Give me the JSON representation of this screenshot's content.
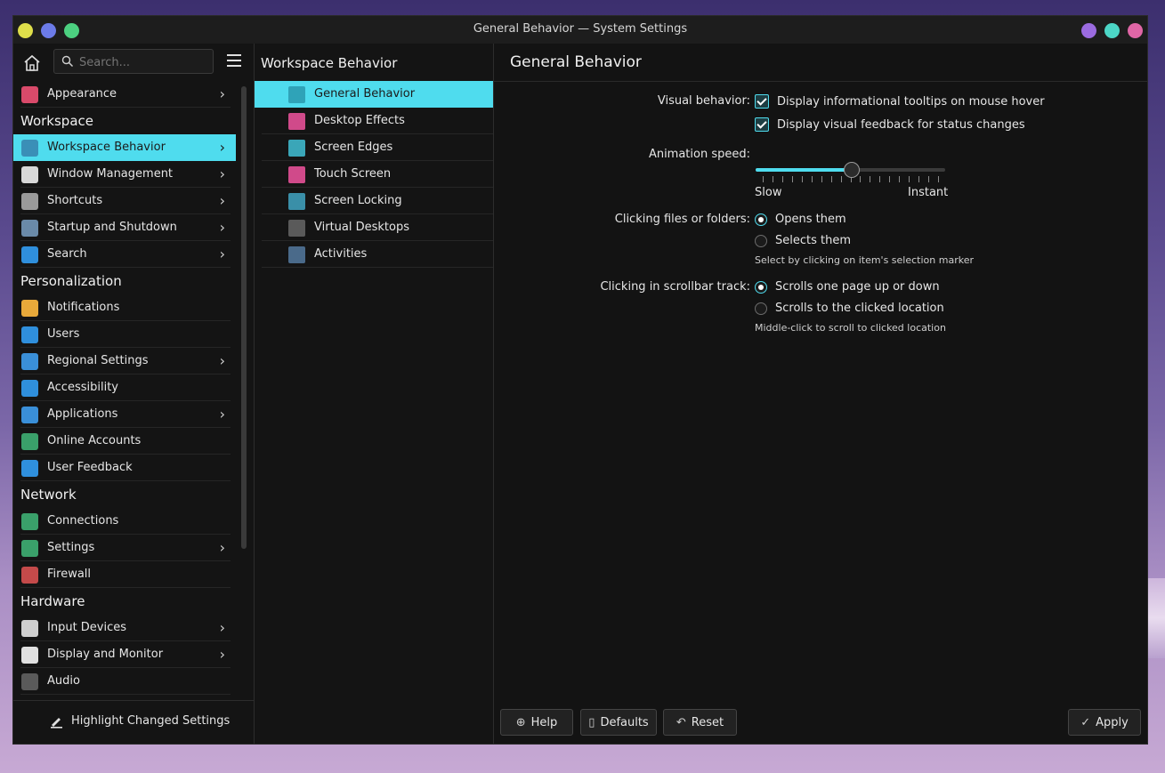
{
  "window": {
    "title": "General Behavior — System Settings",
    "left_buttons": [
      "#dede4a",
      "#6c7be8",
      "#4cd080"
    ],
    "right_buttons": [
      "#9b6be0",
      "#4cd6c6",
      "#e066a6"
    ]
  },
  "sidebar": {
    "search_placeholder": "Search...",
    "items": [
      {
        "kind": "item",
        "label": "Appearance",
        "icon": "appearance-icon",
        "color": "#d94a6a",
        "arrow": true
      },
      {
        "kind": "cat",
        "label": "Workspace"
      },
      {
        "kind": "item",
        "label": "Workspace Behavior",
        "icon": "workspace-behavior-icon",
        "color": "#3a8fb7",
        "arrow": true,
        "selected": true
      },
      {
        "kind": "item",
        "label": "Window Management",
        "icon": "window-management-icon",
        "color": "#d8d8d8",
        "arrow": true
      },
      {
        "kind": "item",
        "label": "Shortcuts",
        "icon": "keyboard-icon",
        "color": "#9a9a9a",
        "arrow": true
      },
      {
        "kind": "item",
        "label": "Startup and Shutdown",
        "icon": "startup-icon",
        "color": "#6a8aa8",
        "arrow": true
      },
      {
        "kind": "item",
        "label": "Search",
        "icon": "search-icon",
        "color": "#2f8fdc",
        "arrow": true
      },
      {
        "kind": "cat",
        "label": "Personalization"
      },
      {
        "kind": "item",
        "label": "Notifications",
        "icon": "bell-icon",
        "color": "#e8a93a",
        "arrow": false
      },
      {
        "kind": "item",
        "label": "Users",
        "icon": "users-icon",
        "color": "#2f8fdc",
        "arrow": false
      },
      {
        "kind": "item",
        "label": "Regional Settings",
        "icon": "regional-icon",
        "color": "#3a8fd8",
        "arrow": true
      },
      {
        "kind": "item",
        "label": "Accessibility",
        "icon": "accessibility-icon",
        "color": "#2f8fdc",
        "arrow": false
      },
      {
        "kind": "item",
        "label": "Applications",
        "icon": "applications-icon",
        "color": "#3a8fd8",
        "arrow": true
      },
      {
        "kind": "item",
        "label": "Online Accounts",
        "icon": "globe-icon",
        "color": "#3aa06a",
        "arrow": false
      },
      {
        "kind": "item",
        "label": "User Feedback",
        "icon": "feedback-icon",
        "color": "#2f8fdc",
        "arrow": false
      },
      {
        "kind": "cat",
        "label": "Network"
      },
      {
        "kind": "item",
        "label": "Connections",
        "icon": "connections-icon",
        "color": "#3aa06a",
        "arrow": false
      },
      {
        "kind": "item",
        "label": "Settings",
        "icon": "network-settings-icon",
        "color": "#3aa06a",
        "arrow": true
      },
      {
        "kind": "item",
        "label": "Firewall",
        "icon": "firewall-icon",
        "color": "#c44a4a",
        "arrow": false
      },
      {
        "kind": "cat",
        "label": "Hardware"
      },
      {
        "kind": "item",
        "label": "Input Devices",
        "icon": "mouse-icon",
        "color": "#cfcfcf",
        "arrow": true
      },
      {
        "kind": "item",
        "label": "Display and Monitor",
        "icon": "monitor-icon",
        "color": "#e0e0e0",
        "arrow": true
      },
      {
        "kind": "item",
        "label": "Audio",
        "icon": "speaker-icon",
        "color": "#5a5a5a",
        "arrow": false
      }
    ],
    "highlight_button": "Highlight Changed Settings"
  },
  "middle": {
    "title": "Workspace Behavior",
    "items": [
      {
        "label": "General Behavior",
        "icon": "general-behavior-icon",
        "color": "#2fa3b8",
        "selected": true
      },
      {
        "label": "Desktop Effects",
        "icon": "desktop-effects-icon",
        "color": "#d04a8a"
      },
      {
        "label": "Screen Edges",
        "icon": "screen-edges-icon",
        "color": "#3aa6b8"
      },
      {
        "label": "Touch Screen",
        "icon": "touch-screen-icon",
        "color": "#d04a8a"
      },
      {
        "label": "Screen Locking",
        "icon": "screen-locking-icon",
        "color": "#3a8fa8"
      },
      {
        "label": "Virtual Desktops",
        "icon": "virtual-desktops-icon",
        "color": "#5a5a5a"
      },
      {
        "label": "Activities",
        "icon": "activities-icon",
        "color": "#4a6a8a"
      }
    ]
  },
  "content": {
    "title": "General Behavior",
    "visual_behavior_label": "Visual behavior:",
    "tooltips_option": "Display informational tooltips on mouse hover",
    "tooltips_checked": true,
    "feedback_option": "Display visual feedback for status changes",
    "feedback_checked": true,
    "animation_label": "Animation speed:",
    "animation_value": 0.5,
    "slider_min_label": "Slow",
    "slider_max_label": "Instant",
    "slider_ticks": 19,
    "clicking_files_label": "Clicking files or folders:",
    "opens_them": "Opens them",
    "selects_them": "Selects them",
    "select_hint": "Select by clicking on item's selection marker",
    "scrollbar_label": "Clicking in scrollbar track:",
    "scroll_page": "Scrolls one page up or down",
    "scroll_clicked": "Scrolls to the clicked location",
    "scroll_hint": "Middle-click to scroll to clicked location"
  },
  "buttons": {
    "help": "Help",
    "defaults": "Defaults",
    "reset": "Reset",
    "apply": "Apply"
  },
  "accent": "#4fdcee"
}
